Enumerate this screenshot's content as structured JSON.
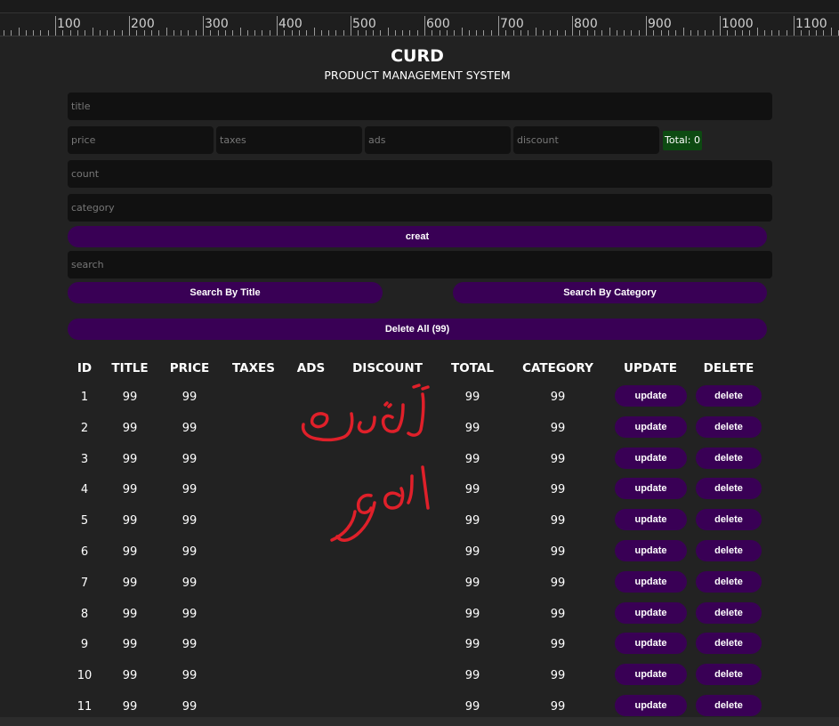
{
  "ruler": {
    "labels": [
      "100",
      "200",
      "300",
      "400",
      "500",
      "600",
      "700",
      "800",
      "900",
      "1000",
      "1100"
    ]
  },
  "header": {
    "title": "CURD",
    "subtitle": "PRODUCT MANAGEMENT SYSTEM"
  },
  "form": {
    "title_placeholder": "title",
    "price_placeholder": "price",
    "taxes_placeholder": "taxes",
    "ads_placeholder": "ads",
    "discount_placeholder": "discount",
    "total_label": "Total: 0",
    "count_placeholder": "count",
    "category_placeholder": "category",
    "create_label": "creat",
    "search_placeholder": "search",
    "search_title_label": "Search By Title",
    "search_category_label": "Search By Category",
    "delete_all_label": "Delete All (99)"
  },
  "table": {
    "headers": {
      "id": "ID",
      "title": "TITLE",
      "price": "PRICE",
      "taxes": "TAXES",
      "ads": "ADS",
      "discount": "DISCOUNT",
      "total": "TOTAL",
      "category": "CATEGORY",
      "update": "UPDATE",
      "delete": "DELETE"
    },
    "rows": [
      {
        "id": "1",
        "title": "99",
        "price": "99",
        "total": "99",
        "category": "99"
      },
      {
        "id": "2",
        "title": "99",
        "price": "99",
        "total": "99",
        "category": "99"
      },
      {
        "id": "3",
        "title": "99",
        "price": "99",
        "total": "99",
        "category": "99"
      },
      {
        "id": "4",
        "title": "99",
        "price": "99",
        "total": "99",
        "category": "99"
      },
      {
        "id": "5",
        "title": "99",
        "price": "99",
        "total": "99",
        "category": "99"
      },
      {
        "id": "6",
        "title": "99",
        "price": "99",
        "total": "99",
        "category": "99"
      },
      {
        "id": "7",
        "title": "99",
        "price": "99",
        "total": "99",
        "category": "99"
      },
      {
        "id": "8",
        "title": "99",
        "price": "99",
        "total": "99",
        "category": "99"
      },
      {
        "id": "9",
        "title": "99",
        "price": "99",
        "total": "99",
        "category": "99"
      },
      {
        "id": "10",
        "title": "99",
        "price": "99",
        "total": "99",
        "category": "99"
      },
      {
        "id": "11",
        "title": "99",
        "price": "99",
        "total": "99",
        "category": "99"
      }
    ],
    "update_label": "update",
    "delete_label": "delete"
  },
  "annotation": {
    "text": "تنظيف الكود",
    "color": "#e0202a"
  },
  "colors": {
    "background": "#222222",
    "button": "#390055",
    "input": "#111111",
    "total_bg": "#0d4a12"
  }
}
